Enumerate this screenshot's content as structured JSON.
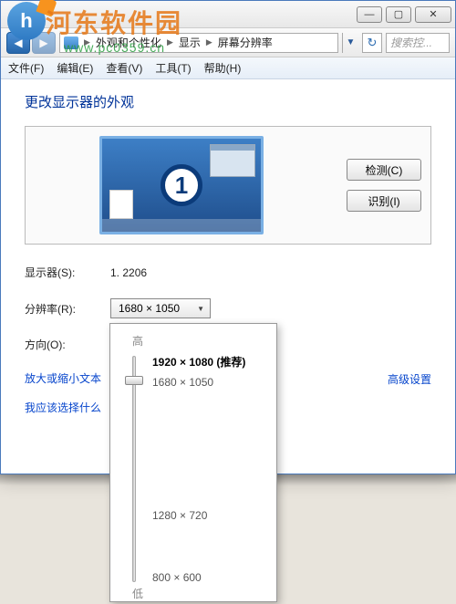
{
  "watermark": {
    "text": "河东软件园",
    "url": "www.pc0359.cn",
    "logo_letter": "h"
  },
  "titlebar": {
    "min": "—",
    "max": "▢",
    "close": "✕"
  },
  "nav": {
    "back": "◀",
    "forward": "▶",
    "refresh": "↻",
    "crumbs": [
      "外观和个性化",
      "显示",
      "屏幕分辨率"
    ],
    "search_placeholder": "搜索控..."
  },
  "menus": {
    "file": "文件(F)",
    "edit": "编辑(E)",
    "view": "查看(V)",
    "tools": "工具(T)",
    "help": "帮助(H)"
  },
  "page": {
    "title": "更改显示器的外观",
    "detect": "检测(C)",
    "identify": "识别(I)",
    "monitor_number": "1",
    "display_label": "显示器(S):",
    "display_value": "1. 2206",
    "resolution_label": "分辨率(R):",
    "resolution_value": "1680 × 1050",
    "orientation_label": "方向(O):",
    "advanced": "高级设置",
    "link_zoom": "放大或缩小文本",
    "link_which": "我应该选择什么"
  },
  "res_popup": {
    "high": "高",
    "low": "低",
    "recommended": "1920 × 1080 (推荐)",
    "opt1": "1680 × 1050",
    "opt2": "1280 × 720",
    "opt3": "800 × 600"
  }
}
